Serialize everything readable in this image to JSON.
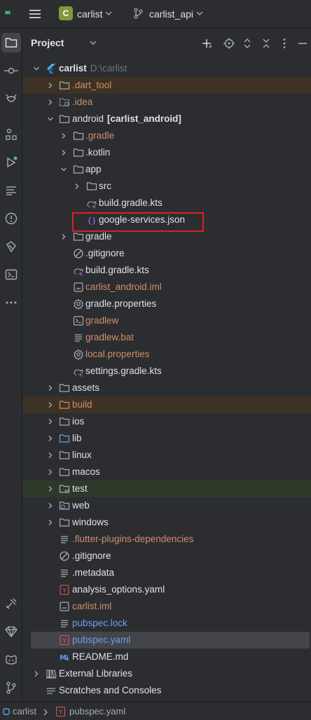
{
  "topbar": {
    "project_badge": "C",
    "project_name": "carlist",
    "branch_name": "carlist_api"
  },
  "panel": {
    "title": "Project"
  },
  "tree": [
    {
      "label": "carlist",
      "suffix": "D:\\carlist",
      "depth": 0,
      "arrow": "down",
      "icon": "flutter",
      "color": "normal",
      "bold": true
    },
    {
      "label": ".dart_tool",
      "depth": 1,
      "arrow": "right",
      "icon": "folder",
      "color": "orange",
      "bg": "excluded"
    },
    {
      "label": ".idea",
      "depth": 1,
      "arrow": "right",
      "icon": "folder-dotted",
      "color": "orange"
    },
    {
      "label": "android",
      "suffix": "[carlist_android]",
      "depth": 1,
      "arrow": "down",
      "icon": "folder",
      "color": "normal"
    },
    {
      "label": ".gradle",
      "depth": 2,
      "arrow": "right",
      "icon": "folder",
      "color": "orange"
    },
    {
      "label": ".kotlin",
      "depth": 2,
      "arrow": "right",
      "icon": "folder",
      "color": "normal"
    },
    {
      "label": "app",
      "depth": 2,
      "arrow": "down",
      "icon": "folder",
      "color": "normal"
    },
    {
      "label": "src",
      "depth": 3,
      "arrow": "right",
      "icon": "folder",
      "color": "normal"
    },
    {
      "label": "build.gradle.kts",
      "depth": 3,
      "arrow": "none",
      "icon": "gradle",
      "color": "normal"
    },
    {
      "label": "google-services.json",
      "depth": 3,
      "arrow": "none",
      "icon": "json",
      "color": "normal"
    },
    {
      "label": "gradle",
      "depth": 2,
      "arrow": "right",
      "icon": "folder",
      "color": "normal"
    },
    {
      "label": ".gitignore",
      "depth": 2,
      "arrow": "none",
      "icon": "ignore",
      "color": "normal"
    },
    {
      "label": "build.gradle.kts",
      "depth": 2,
      "arrow": "none",
      "icon": "gradle",
      "color": "normal"
    },
    {
      "label": "carlist_android.iml",
      "depth": 2,
      "arrow": "none",
      "icon": "iml",
      "color": "orange"
    },
    {
      "label": "gradle.properties",
      "depth": 2,
      "arrow": "none",
      "icon": "gear",
      "color": "normal"
    },
    {
      "label": "gradlew",
      "depth": 2,
      "arrow": "none",
      "icon": "terminal",
      "color": "orange"
    },
    {
      "label": "gradlew.bat",
      "depth": 2,
      "arrow": "none",
      "icon": "lines",
      "color": "orange"
    },
    {
      "label": "local.properties",
      "depth": 2,
      "arrow": "none",
      "icon": "gear",
      "color": "orange"
    },
    {
      "label": "settings.gradle.kts",
      "depth": 2,
      "arrow": "none",
      "icon": "gradle",
      "color": "normal"
    },
    {
      "label": "assets",
      "depth": 1,
      "arrow": "right",
      "icon": "folder",
      "color": "normal"
    },
    {
      "label": "build",
      "depth": 1,
      "arrow": "right",
      "icon": "folder-orange",
      "color": "orange",
      "bg": "excluded"
    },
    {
      "label": "ios",
      "depth": 1,
      "arrow": "right",
      "icon": "folder",
      "color": "normal"
    },
    {
      "label": "lib",
      "depth": 1,
      "arrow": "right",
      "icon": "folder-blue",
      "color": "normal"
    },
    {
      "label": "linux",
      "depth": 1,
      "arrow": "right",
      "icon": "folder",
      "color": "normal"
    },
    {
      "label": "macos",
      "depth": 1,
      "arrow": "right",
      "icon": "folder",
      "color": "normal"
    },
    {
      "label": "test",
      "depth": 1,
      "arrow": "right",
      "icon": "folder-test",
      "color": "normal",
      "bg": "test"
    },
    {
      "label": "web",
      "depth": 1,
      "arrow": "right",
      "icon": "folder-web",
      "color": "normal"
    },
    {
      "label": "windows",
      "depth": 1,
      "arrow": "right",
      "icon": "folder",
      "color": "normal"
    },
    {
      "label": ".flutter-plugins-dependencies",
      "depth": 1,
      "arrow": "none",
      "icon": "lines",
      "color": "orange"
    },
    {
      "label": ".gitignore",
      "depth": 1,
      "arrow": "none",
      "icon": "ignore",
      "color": "normal"
    },
    {
      "label": ".metadata",
      "depth": 1,
      "arrow": "none",
      "icon": "lines",
      "color": "normal"
    },
    {
      "label": "analysis_options.yaml",
      "depth": 1,
      "arrow": "none",
      "icon": "yaml",
      "color": "normal"
    },
    {
      "label": "carlist.iml",
      "depth": 1,
      "arrow": "none",
      "icon": "iml",
      "color": "orange"
    },
    {
      "label": "pubspec.lock",
      "depth": 1,
      "arrow": "none",
      "icon": "lines",
      "color": "blue"
    },
    {
      "label": "pubspec.yaml",
      "depth": 1,
      "arrow": "none",
      "icon": "yaml",
      "color": "blue",
      "selected": true
    },
    {
      "label": "README.md",
      "depth": 1,
      "arrow": "none",
      "icon": "markdown",
      "color": "normal"
    },
    {
      "label": "External Libraries",
      "depth": 0,
      "arrow": "right",
      "icon": "library",
      "color": "normal"
    },
    {
      "label": "Scratches and Consoles",
      "depth": 0,
      "arrow": "none",
      "icon": "scratches",
      "color": "normal"
    }
  ],
  "statusbar": {
    "project": "carlist",
    "file": "pubspec.yaml"
  }
}
